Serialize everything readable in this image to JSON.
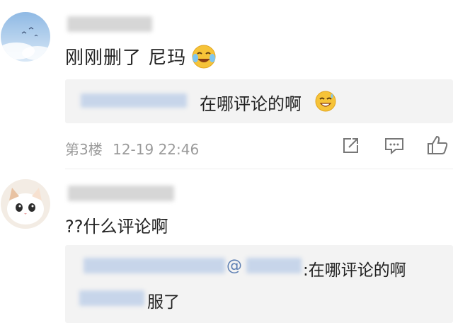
{
  "comments": [
    {
      "author": "",
      "text": "刚刚删了 尼玛",
      "emoji": "crying-laughing-emoji",
      "quote_text": "在哪评论的啊",
      "quote_emoji": "sweat-smile-emoji",
      "floor_label": "第3楼",
      "timestamp": "12-19 22:46",
      "actions": [
        "share-icon",
        "comment-icon",
        "like-icon"
      ]
    },
    {
      "author": "",
      "text": "??什么评论啊",
      "quote_line1_at": "@",
      "quote_line1_text": ":在哪评论的啊",
      "quote_line2_text": "服了"
    }
  ],
  "colors": {
    "text": "#222222",
    "meta": "#9a9a9a",
    "quote_bg": "#f3f3f3",
    "mention": "#5d7fb3"
  }
}
